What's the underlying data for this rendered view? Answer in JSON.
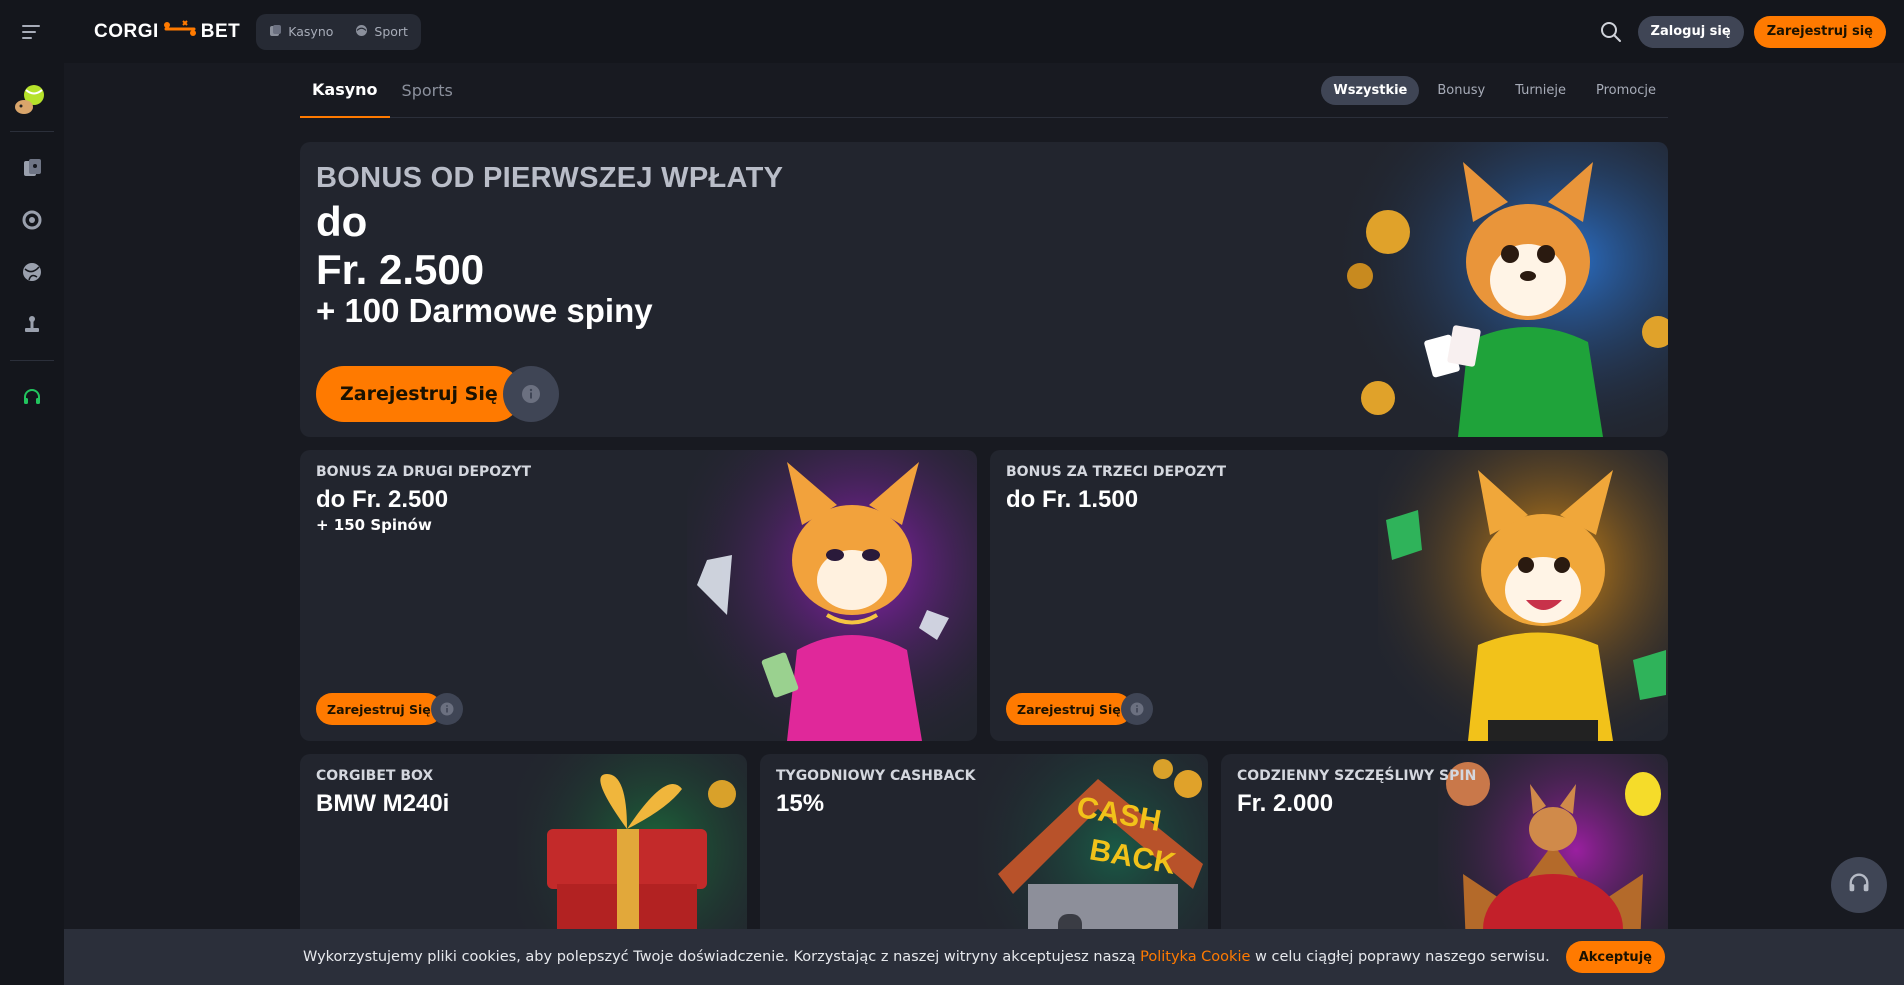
{
  "header": {
    "logo_left": "CORGI",
    "logo_right": "BET",
    "nav": [
      {
        "label": "Kasyno",
        "icon": "casino-icon"
      },
      {
        "label": "Sport",
        "icon": "sport-icon"
      }
    ],
    "login_label": "Zaloguj się",
    "register_label": "Zarejestruj się"
  },
  "sidebar": {
    "items": [
      "casino-icon",
      "live-icon",
      "sport-icon",
      "esport-icon",
      "support-icon"
    ]
  },
  "tabs": {
    "main": [
      "Kasyno",
      "Sports"
    ],
    "active_main": "Kasyno",
    "filters": [
      "Wszystkie",
      "Bonusy",
      "Turnieje",
      "Promocje"
    ],
    "active_filter": "Wszystkie"
  },
  "hero": {
    "subtitle": "BONUS OD PIERWSZEJ WPŁATY",
    "line1": "do",
    "line2": "Fr. 2.500",
    "line3": "+ 100 Darmowe spiny",
    "cta": "Zarejestruj Się"
  },
  "cards": [
    {
      "title": "BONUS ZA DRUGI DEPOZYT",
      "value": "do Fr. 2.500",
      "extra": "+ 150 Spinów",
      "cta": "Zarejestruj Się"
    },
    {
      "title": "BONUS ZA TRZECI DEPOZYT",
      "value": "do Fr. 1.500",
      "cta": "Zarejestruj Się"
    },
    {
      "title": "CORGIBET BOX",
      "value": "BMW M240i"
    },
    {
      "title": "TYGODNIOWY CASHBACK",
      "value": "15%"
    },
    {
      "title": "CODZIENNY SZCZĘŚLIWY SPIN",
      "value": "Fr. 2.000"
    }
  ],
  "cookie": {
    "text_before": "Wykorzystujemy pliki cookies, aby polepszyć Twoje doświadczenie. Korzystając z naszej witryny akceptujesz naszą",
    "link": "Polityka Cookie",
    "text_after": "w celu ciągłej poprawy naszego serwisu.",
    "accept": "Akceptuję"
  },
  "colors": {
    "accent": "#ff7a00",
    "background": "#181a21",
    "panel": "#22252e",
    "green": "#22c55e"
  }
}
